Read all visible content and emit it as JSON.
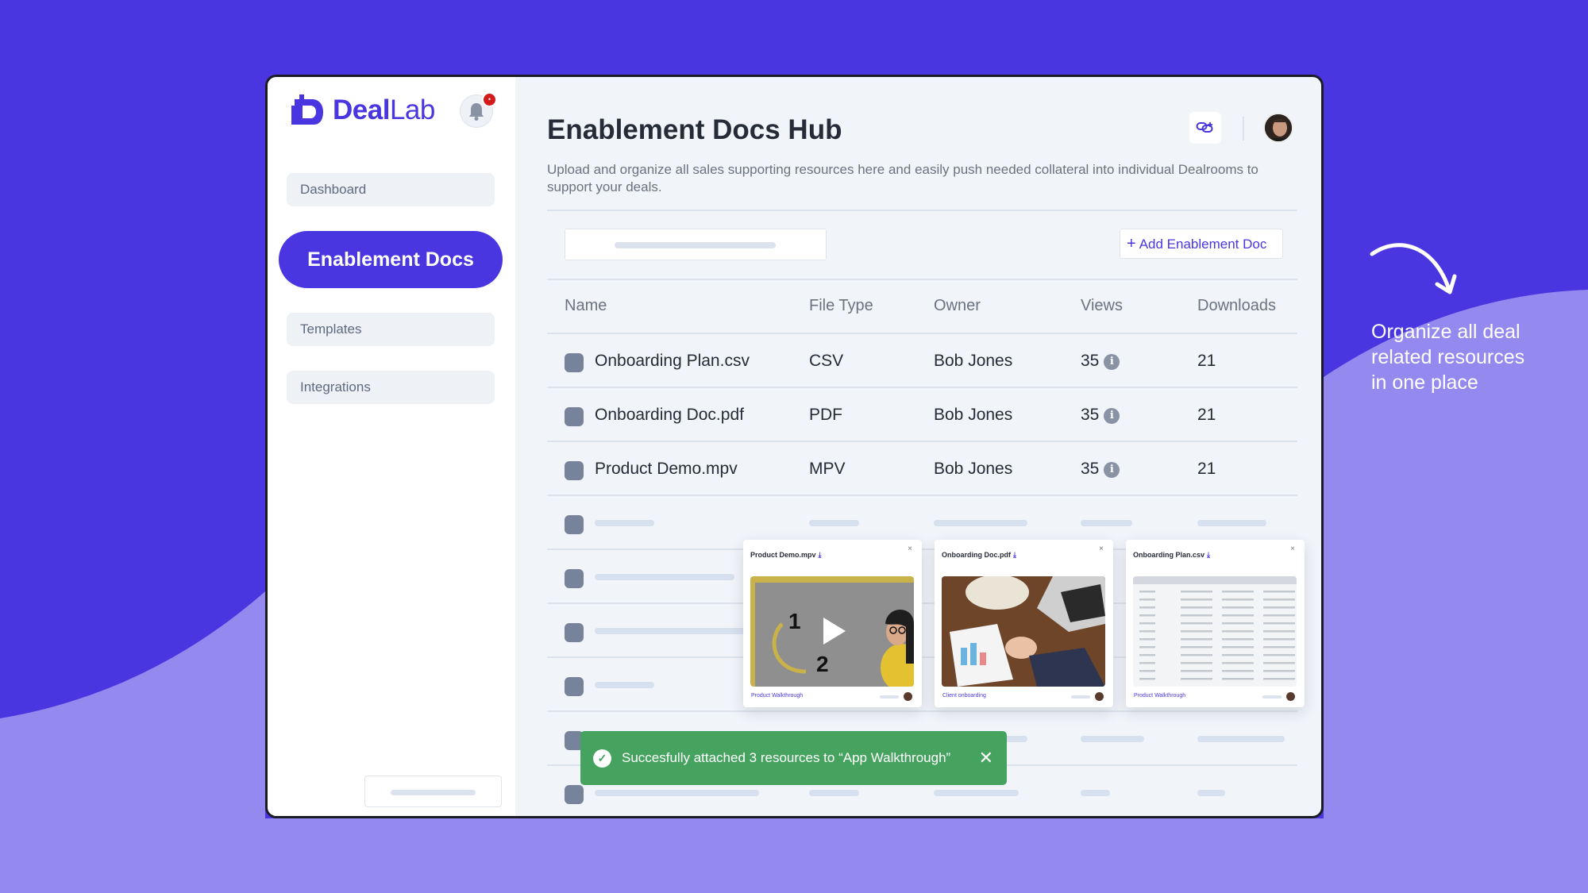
{
  "colors": {
    "brand": "#4936E0",
    "brand_light": "#9489EE",
    "toast_success": "#45A35F",
    "notification_dot": "#D21B1B"
  },
  "app": {
    "logo_bold": "Deal",
    "logo_regular": "Lab"
  },
  "sidebar": {
    "items": [
      {
        "label": "Dashboard",
        "active": false
      },
      {
        "label": "Enablement Docs",
        "active": true
      },
      {
        "label": "Templates",
        "active": false
      },
      {
        "label": "Integrations",
        "active": false
      }
    ]
  },
  "header": {
    "title": "Enablement Docs Hub",
    "description": "Upload and organize all sales supporting resources here and easily push needed collateral into individual Dealrooms to support your deals."
  },
  "toolbar": {
    "add_label": "Add Enablement Doc"
  },
  "table": {
    "headers": [
      "Name",
      "File Type",
      "Owner",
      "Views",
      "Downloads"
    ],
    "rows": [
      {
        "name": "Onboarding Plan.csv",
        "type": "CSV",
        "owner": "Bob Jones",
        "views": "35",
        "downloads": "21"
      },
      {
        "name": "Onboarding Doc.pdf",
        "type": "PDF",
        "owner": "Bob Jones",
        "views": "35",
        "downloads": "21"
      },
      {
        "name": "Product Demo.mpv",
        "type": "MPV",
        "owner": "Bob Jones",
        "views": "35",
        "downloads": "21"
      }
    ]
  },
  "previews": [
    {
      "title": "Product Demo.mpv",
      "footer": "Product Walkthrough",
      "num1": "1",
      "num2": "2"
    },
    {
      "title": "Onboarding Doc.pdf",
      "footer": "Client onboarding"
    },
    {
      "title": "Onboarding Plan.csv",
      "footer": "Product Walkthrough"
    }
  ],
  "toast": {
    "message": "Succesfully attached 3 resources to “App Walkthrough”"
  },
  "callout": {
    "text": "Organize all deal related resources in one place"
  }
}
